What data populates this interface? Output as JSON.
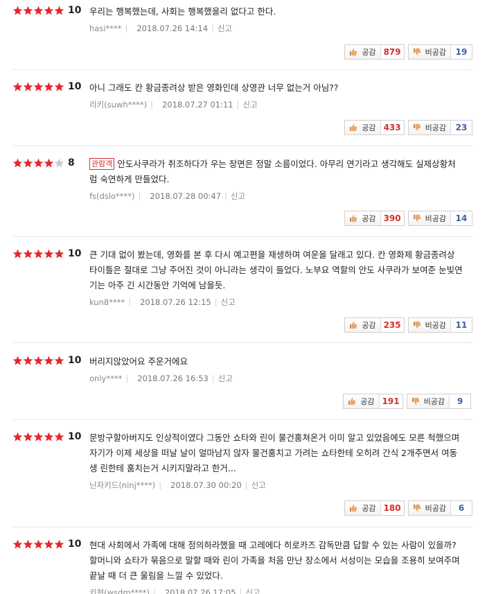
{
  "labels": {
    "like": "공감",
    "dislike": "비공감",
    "report": "신고",
    "viewer_badge": "관람객"
  },
  "colors": {
    "star_on": "#e6262c",
    "star_off": "#c8c8c8",
    "like_count": "#d32f2f",
    "dislike_count": "#3f5fa0"
  },
  "reviews": [
    {
      "stars": 5,
      "score": "10",
      "badge": "",
      "text": "우리는 행복했는데, 사회는 행복했을리 없다고 한다.",
      "author": "hasi****",
      "date": "2018.07.26 14:14",
      "likes": "879",
      "dislikes": "19"
    },
    {
      "stars": 5,
      "score": "10",
      "badge": "",
      "text": "아니 그래도 칸 황금종려상 받은 영화인데 상영관 너무 없는거 아님??",
      "author": "리키(suwh****)",
      "date": "2018.07.27 01:11",
      "likes": "433",
      "dislikes": "23"
    },
    {
      "stars": 4,
      "score": "8",
      "badge": "관람객",
      "text": "안도사쿠라가 취조하다가 우는 장면은 정말 소름이었다. 아무리 연기라고 생각해도 실제상황처럼 숙연하게 만들었다.",
      "author": "fs(dslo****)",
      "date": "2018.07.28 00:47",
      "likes": "390",
      "dislikes": "14"
    },
    {
      "stars": 5,
      "score": "10",
      "badge": "",
      "text": "큰 기대 없이 봤는데, 영화를 본 후 다시 예고편을 재생하며 여운을 달래고 있다. 칸 영화제 황금종려상 타이틀은 절대로 그냥 주어진 것이 아니라는 생각이 들었다. 노부요 역할의 안도 사쿠라가 보여준 눈빛연기는 아주 긴 시간동안 기억에 남을듯.",
      "author": "kun8****",
      "date": "2018.07.26 12:15",
      "likes": "235",
      "dislikes": "11"
    },
    {
      "stars": 5,
      "score": "10",
      "badge": "",
      "text": "버리지않았어요 주운거에요",
      "author": "only****",
      "date": "2018.07.26 16:53",
      "likes": "191",
      "dislikes": "9"
    },
    {
      "stars": 5,
      "score": "10",
      "badge": "",
      "text": "문방구할아버지도 인상적이였다 그동안 쇼타와 린이 물건훔쳐온거 이미 알고 있었음에도 모른 척했으며 자기가 이제 세상을 떠날 날이 얼마남지 않자 물건훔치고 가려는 쇼타한테 오히려 간식 2개주면서 여동생 린한테 훔치는거 시키지말라고 한거...",
      "author": "닌자키드(ninj****)",
      "date": "2018.07.30 00:20",
      "likes": "180",
      "dislikes": "6"
    },
    {
      "stars": 5,
      "score": "10",
      "badge": "",
      "text": "현대 사회에서 가족에 대해 정의하라했을 때 고레에다 히로카즈 감독만큼 답할 수 있는 사람이 있을까? 할머니와 쇼타가 묶음으로 말할 때와 린이 가족을 처음 만난 장소에서 서성이는 모습을 조용히 보여주며 끝날 때 더 큰 울림을 느낄 수 있었다.",
      "author": "키현(wsdm****)",
      "date": "2018.07.26 17:05",
      "likes": "",
      "dislikes": ""
    }
  ]
}
